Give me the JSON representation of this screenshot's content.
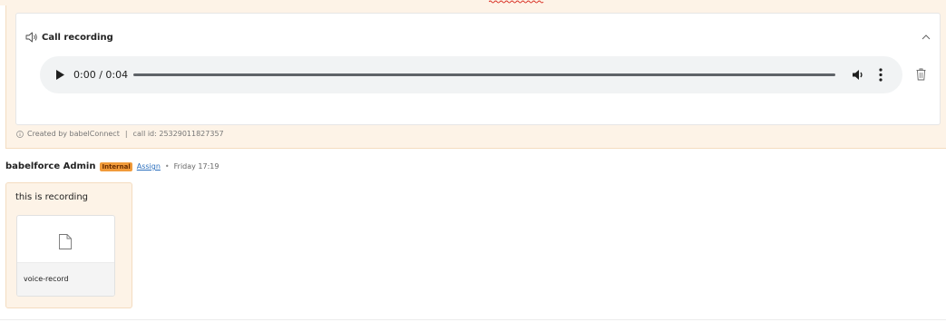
{
  "recording": {
    "title": "Call recording",
    "player": {
      "time_display": "0:00 / 0:04",
      "progress": 0
    },
    "footer": {
      "created_by": "Created by babelConnect",
      "separator": "|",
      "call_id": "call id: 25329011827357"
    }
  },
  "message": {
    "author": "babelforce Admin",
    "badge": "Internal",
    "assign_label": "Assign",
    "separator": "•",
    "timestamp": "Friday 17:19",
    "text": "this is recording",
    "attachment": {
      "name": "voice-record",
      "icon": "file-icon"
    }
  },
  "colors": {
    "card_background": "#fdf3e7",
    "badge": "#f19b3a",
    "link": "#2a6ebd",
    "player_background": "#f1f3f4"
  }
}
